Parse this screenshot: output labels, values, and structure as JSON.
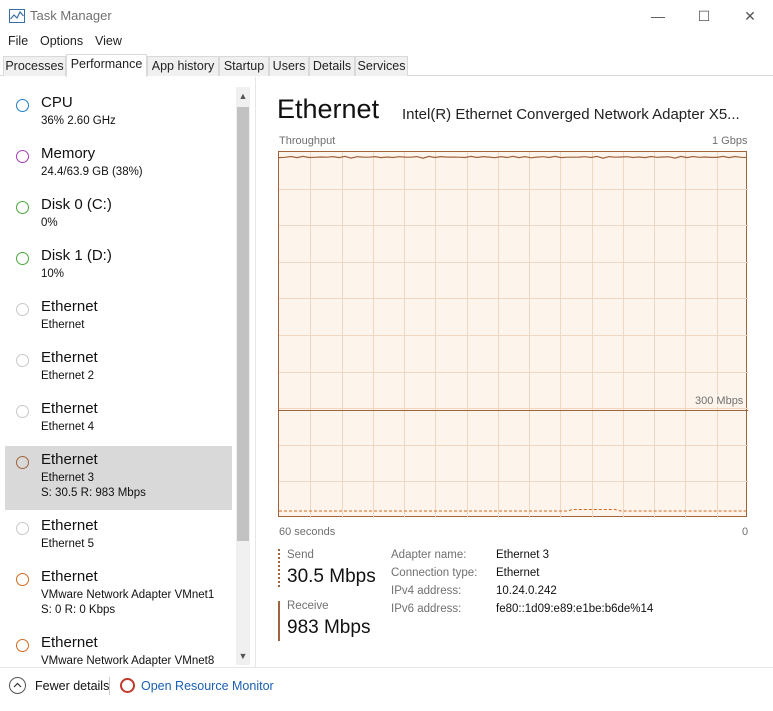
{
  "window": {
    "title": "Task Manager",
    "controls": {
      "minimize": "—",
      "maximize": "☐",
      "close": "✕"
    }
  },
  "menu": [
    "File",
    "Options",
    "View"
  ],
  "tabs": [
    {
      "label": "Processes",
      "active": false
    },
    {
      "label": "Performance",
      "active": true
    },
    {
      "label": "App history",
      "active": false
    },
    {
      "label": "Startup",
      "active": false
    },
    {
      "label": "Users",
      "active": false
    },
    {
      "label": "Details",
      "active": false
    },
    {
      "label": "Services",
      "active": false
    }
  ],
  "sidebar": {
    "items": [
      {
        "title": "CPU",
        "sub": "36% 2.60 GHz",
        "sub2": "",
        "color": "#1e7fcb",
        "selected": false
      },
      {
        "title": "Memory",
        "sub": "24.4/63.9 GB (38%)",
        "sub2": "",
        "color": "#a23bb5",
        "selected": false
      },
      {
        "title": "Disk 0 (C:)",
        "sub": "0%",
        "sub2": "",
        "color": "#4aa83a",
        "selected": false
      },
      {
        "title": "Disk 1 (D:)",
        "sub": "10%",
        "sub2": "",
        "color": "#4aa83a",
        "selected": false
      },
      {
        "title": "Ethernet",
        "sub": "Ethernet",
        "sub2": "",
        "color": "#c8c8c8",
        "selected": false
      },
      {
        "title": "Ethernet",
        "sub": "Ethernet 2",
        "sub2": "",
        "color": "#c8c8c8",
        "selected": false
      },
      {
        "title": "Ethernet",
        "sub": "Ethernet 4",
        "sub2": "",
        "color": "#c8c8c8",
        "selected": false
      },
      {
        "title": "Ethernet",
        "sub": "Ethernet 3",
        "sub2": "S: 30.5 R: 983 Mbps",
        "color": "#a0643c",
        "selected": true
      },
      {
        "title": "Ethernet",
        "sub": "Ethernet 5",
        "sub2": "",
        "color": "#c8c8c8",
        "selected": false
      },
      {
        "title": "Ethernet",
        "sub": "VMware Network Adapter VMnet1",
        "sub2": "S: 0 R: 0 Kbps",
        "color": "#d2691e",
        "selected": false
      },
      {
        "title": "Ethernet",
        "sub": "VMware Network Adapter VMnet8",
        "sub2": "",
        "color": "#d2691e",
        "selected": false
      }
    ]
  },
  "main": {
    "title": "Ethernet",
    "adapter": "Intel(R) Ethernet Converged Network Adapter X5...",
    "throughput_label": "Throughput",
    "max_label": "1 Gbps",
    "mid_label": "300 Mbps",
    "x_left_label": "60 seconds",
    "x_right_label": "0",
    "accent": "#a0643c",
    "send": {
      "label": "Send",
      "value": "30.5 Mbps"
    },
    "receive": {
      "label": "Receive",
      "value": "983 Mbps"
    },
    "info": [
      {
        "key": "Adapter name:",
        "value": "Ethernet 3"
      },
      {
        "key": "Connection type:",
        "value": "Ethernet"
      },
      {
        "key": "IPv4 address:",
        "value": "10.24.0.242"
      },
      {
        "key": "IPv6 address:",
        "value": "fe80::1d09:e89:e1be:b6de%14"
      }
    ]
  },
  "footer": {
    "fewer_details": "Fewer details",
    "open_resmon": "Open Resource Monitor"
  }
}
